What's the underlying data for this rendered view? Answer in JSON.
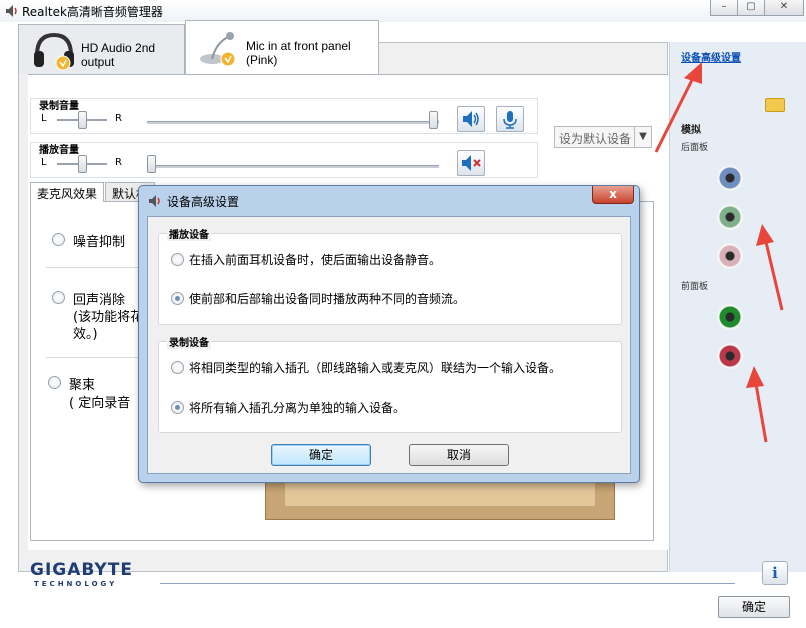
{
  "window": {
    "title": "Realtek高清晰音频管理器",
    "minimize": "–",
    "maximize": "▢",
    "close": "✕"
  },
  "device_tabs": [
    {
      "label": "HD Audio 2nd output"
    },
    {
      "label": "Mic in at front panel (Pink)"
    }
  ],
  "record_volume": {
    "title": "录制音量",
    "left": "L",
    "right": "R"
  },
  "playback_volume": {
    "title": "播放音量",
    "left": "L",
    "right": "R"
  },
  "default_device": {
    "label": "设为默认设备",
    "arrow": "▼"
  },
  "effect_tabs": [
    {
      "label": "麦克风效果"
    },
    {
      "label": "默认格"
    }
  ],
  "effects": {
    "noise": "噪音抑制",
    "echo": "回声消除",
    "echo_desc1": "(该功能将花",
    "echo_desc2": "效。)",
    "beam": "聚束",
    "beam_desc": "( 定向录音"
  },
  "right_panel": {
    "advanced_link": "设备高级设置",
    "analog": "模拟",
    "rear_panel": "后面板",
    "front_panel": "前面板",
    "jack_colors": {
      "rear_blue": "#6f8fc0",
      "rear_green": "#7fb08a",
      "rear_pink": "#d8b0ba",
      "front_green": "#1f8a2c",
      "front_pink": "#b83a4a"
    }
  },
  "footer": {
    "logo": "GIGABYTE",
    "logo_sub": "TECHNOLOGY",
    "info": "i",
    "ok": "确定"
  },
  "dialog": {
    "title": "设备高级设置",
    "close": "x",
    "playback_group": {
      "title": "播放设备",
      "option1": "在插入前面耳机设备时，使后面输出设备静音。",
      "option2": "使前部和后部输出设备同时播放两种不同的音频流。",
      "selected": 2
    },
    "record_group": {
      "title": "录制设备",
      "option1": "将相同类型的输入插孔（即线路输入或麦克风）联结为一个输入设备。",
      "option2": "将所有输入插孔分离为单独的输入设备。",
      "selected": 2
    },
    "ok": "确定",
    "cancel": "取消"
  },
  "annotation_color": "#e8463a"
}
